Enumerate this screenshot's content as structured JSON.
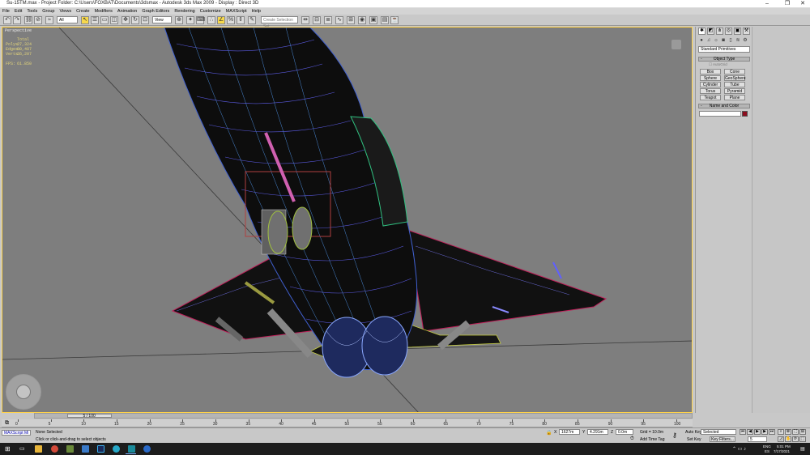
{
  "window": {
    "title": "Su-15TM.max    - Project Folder: C:\\Users\\FOXBAT\\Documents\\3dsmax    - Autodesk 3ds Max  2009      - Display : Direct 3D",
    "controls": [
      "–",
      "❐",
      "✕"
    ]
  },
  "menu": [
    "File",
    "Edit",
    "Tools",
    "Group",
    "Views",
    "Create",
    "Modifiers",
    "Animation",
    "Graph Editors",
    "Rendering",
    "Customize",
    "MAXScript",
    "Help"
  ],
  "toolbar": {
    "filter_value": "All",
    "refcoord_value": "View",
    "named_sel_placeholder": "Create Selection Set"
  },
  "viewport": {
    "label": "Perspective",
    "stats": [
      {
        "label": "",
        "value": "Total"
      },
      {
        "label": "Polys:",
        "value": "27,324"
      },
      {
        "label": "Edges:",
        "value": "80,487"
      },
      {
        "label": "Verts:",
        "value": "26,207"
      },
      {
        "label": "FPS:",
        "value": "61.850"
      }
    ]
  },
  "command_panel": {
    "dropdown_value": "Standard Primitives",
    "rollout_object_type": "Object Type",
    "autogrid_label": "AutoGrid",
    "objects": [
      "Box",
      "Cone",
      "Sphere",
      "GeoSphere",
      "Cylinder",
      "Tube",
      "Torus",
      "Pyramid",
      "Teapot",
      "Plane"
    ],
    "rollout_name_color": "Name and Color",
    "swatch_color": "#8c0d1e"
  },
  "time_slider": {
    "frame_label": "5 / 100",
    "ticks": [
      "0",
      "5",
      "10",
      "15",
      "20",
      "25",
      "30",
      "35",
      "40",
      "45",
      "50",
      "55",
      "60",
      "65",
      "70",
      "75",
      "80",
      "85",
      "90",
      "95",
      "100"
    ],
    "current_frame_fraction": 0.05
  },
  "status": {
    "listener_label": "MAXScript Mi",
    "selection": "None Selected",
    "prompt": "Click or click-and-drag to select objects",
    "x_value": "1627m",
    "y_value": "4.291m",
    "z_value": "0.0m",
    "grid": "Grid = 10.0m",
    "add_time_tag": "Add Time Tag",
    "auto_key": "Auto Key",
    "set_key": "Set Key",
    "selected": "Selected",
    "key_filters": "Key Filters...",
    "frame": "5"
  },
  "taskbar": {
    "lang": "ENG",
    "region": "ES",
    "time": "5:01 PM",
    "date": "7/17/2021"
  }
}
